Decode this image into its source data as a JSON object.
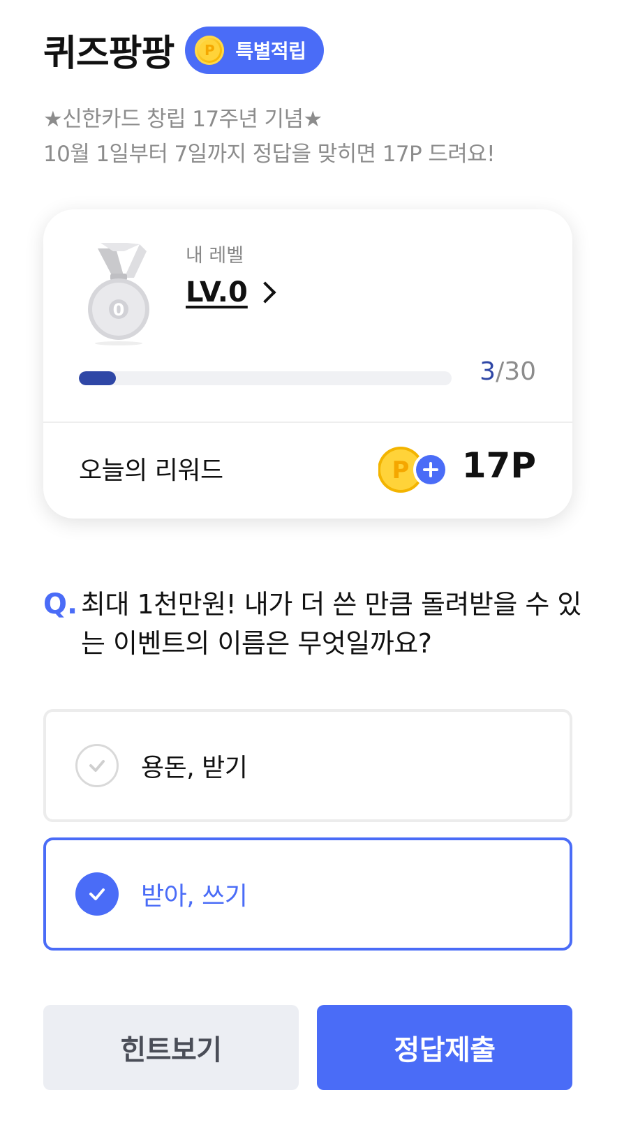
{
  "header": {
    "title": "퀴즈팡팡",
    "badge_label": "특별적립",
    "badge_icon": "point-coin-icon"
  },
  "subtitle": {
    "line1": "★신한카드 창립 17주년 기념★",
    "line2": "10월 1일부터 7일까지 정답을 맞히면 17P 드려요!"
  },
  "level_card": {
    "level_label": "내 레벨",
    "level_value": "LV.0",
    "medal_number": "0",
    "progress_current": "3",
    "progress_total": "/30",
    "progress_fraction": 0.1,
    "reward_label": "오늘의 리워드",
    "reward_value": "17P"
  },
  "question": {
    "mark": "Q.",
    "text": "최대 1천만원! 내가 더 쓴 만큼 돌려받을 수 있는 이벤트의 이름은 무엇일까요?"
  },
  "options": [
    {
      "label": "용돈, 받기",
      "selected": false
    },
    {
      "label": "받아, 쓰기",
      "selected": true
    }
  ],
  "buttons": {
    "hint": "힌트보기",
    "submit": "정답제출"
  },
  "colors": {
    "accent": "#4a6cf7",
    "progress": "#2f47a6",
    "muted_text": "#8c8c8c"
  }
}
